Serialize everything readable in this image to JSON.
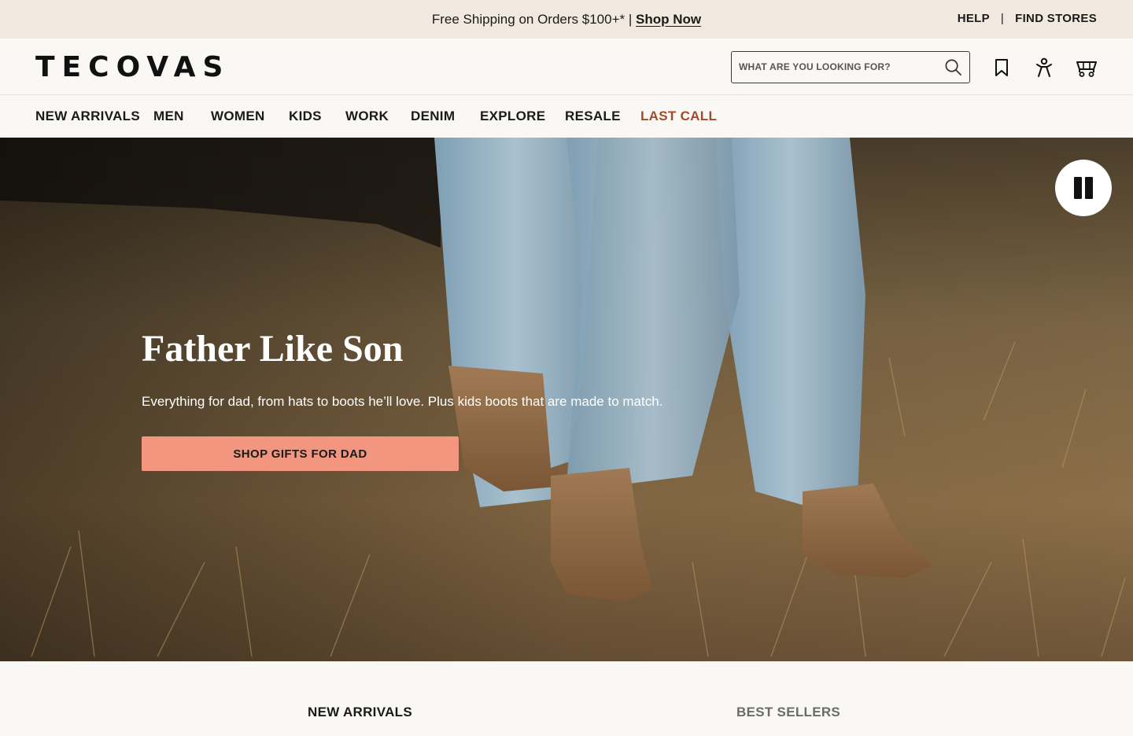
{
  "promo": {
    "text": "Free Shipping on Orders $100+* |",
    "link": "Shop Now"
  },
  "utility": {
    "help": "HELP",
    "separator": "|",
    "find_stores": "FIND STORES"
  },
  "header": {
    "logo": "TECOVAS",
    "search_placeholder": "WHAT ARE YOU LOOKING FOR?",
    "icons": [
      "search-icon",
      "bookmark-icon",
      "account-icon",
      "cart-icon"
    ]
  },
  "nav": {
    "items": [
      {
        "label": "NEW ARRIVALS"
      },
      {
        "label": "MEN"
      },
      {
        "label": "WOMEN"
      },
      {
        "label": "KIDS"
      },
      {
        "label": "WORK"
      },
      {
        "label": "DENIM"
      },
      {
        "label": "EXPLORE"
      },
      {
        "label": "RESALE"
      },
      {
        "label": "LAST CALL"
      }
    ],
    "accent_color": "#a24a28"
  },
  "hero": {
    "title": "Father Like Son",
    "subtitle": "Everything for dad, from hats to boots he’ll love. Plus kids boots that are made to match.",
    "cta": "SHOP GIFTS FOR DAD",
    "cta_color": "#f2967f",
    "video_control": "pause-icon"
  },
  "tabs": {
    "items": [
      {
        "label": "NEW ARRIVALS",
        "active": true
      },
      {
        "label": "BEST SELLERS",
        "active": false
      }
    ]
  }
}
